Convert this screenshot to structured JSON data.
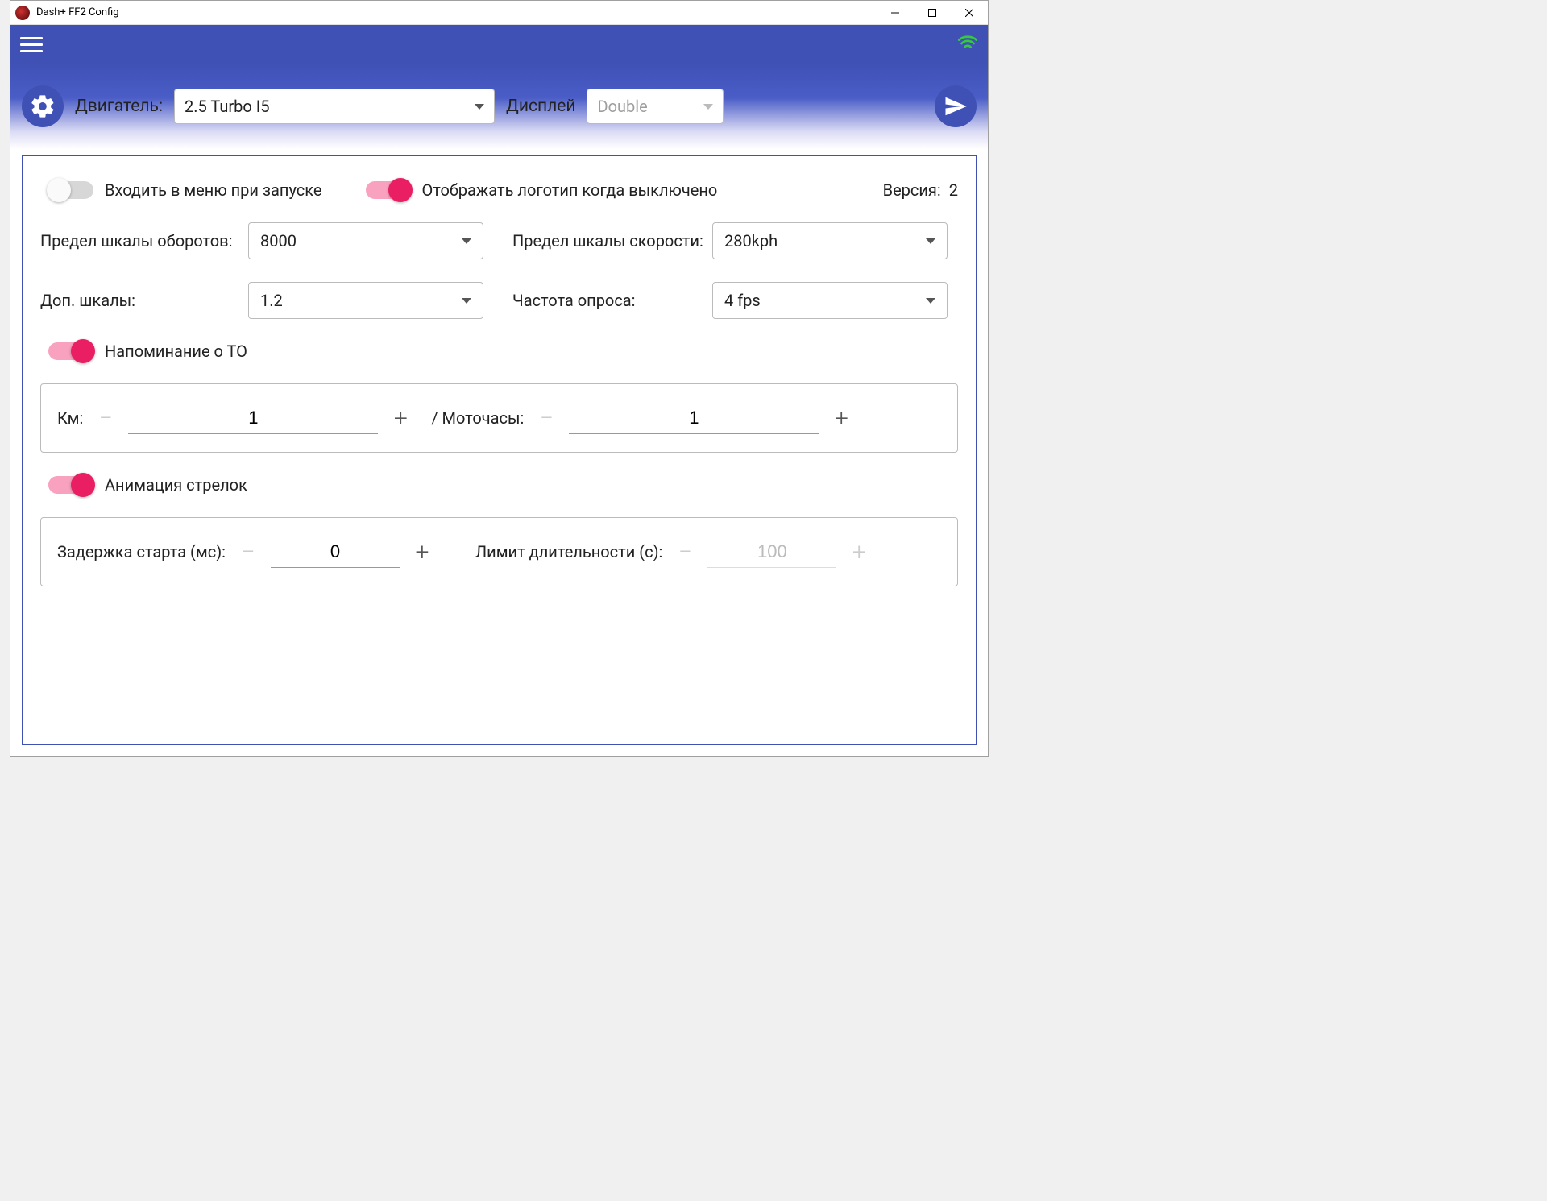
{
  "window": {
    "title": "Dash+ FF2 Config"
  },
  "header": {
    "engine_label": "Двигатель:",
    "engine_value": "2.5 Turbo I5",
    "display_label": "Дисплей",
    "display_value": "Double"
  },
  "toggles": {
    "menu_on_start": {
      "label": "Входить в меню при запуске",
      "on": false
    },
    "show_logo": {
      "label": "Отображать логотип когда выключено",
      "on": true
    },
    "service_reminder": {
      "label": "Напоминание о ТО",
      "on": true
    },
    "needle_anim": {
      "label": "Анимация стрелок",
      "on": true
    }
  },
  "version": {
    "label": "Версия:",
    "value": "2"
  },
  "form": {
    "rpm_limit_label": "Предел шкалы оборотов:",
    "rpm_limit_value": "8000",
    "speed_limit_label": "Предел шкалы скорости:",
    "speed_limit_value": "280kph",
    "aux_scales_label": "Доп. шкалы:",
    "aux_scales_value": "1.2",
    "poll_rate_label": "Частота опроса:",
    "poll_rate_value": "4 fps"
  },
  "service_box": {
    "km_label": "Км:",
    "km_value": "1",
    "hours_label": "/ Моточасы:",
    "hours_value": "1"
  },
  "anim_box": {
    "delay_label": "Задержка старта (мс):",
    "delay_value": "0",
    "limit_label": "Лимит длительности (с):",
    "limit_value": "100"
  }
}
